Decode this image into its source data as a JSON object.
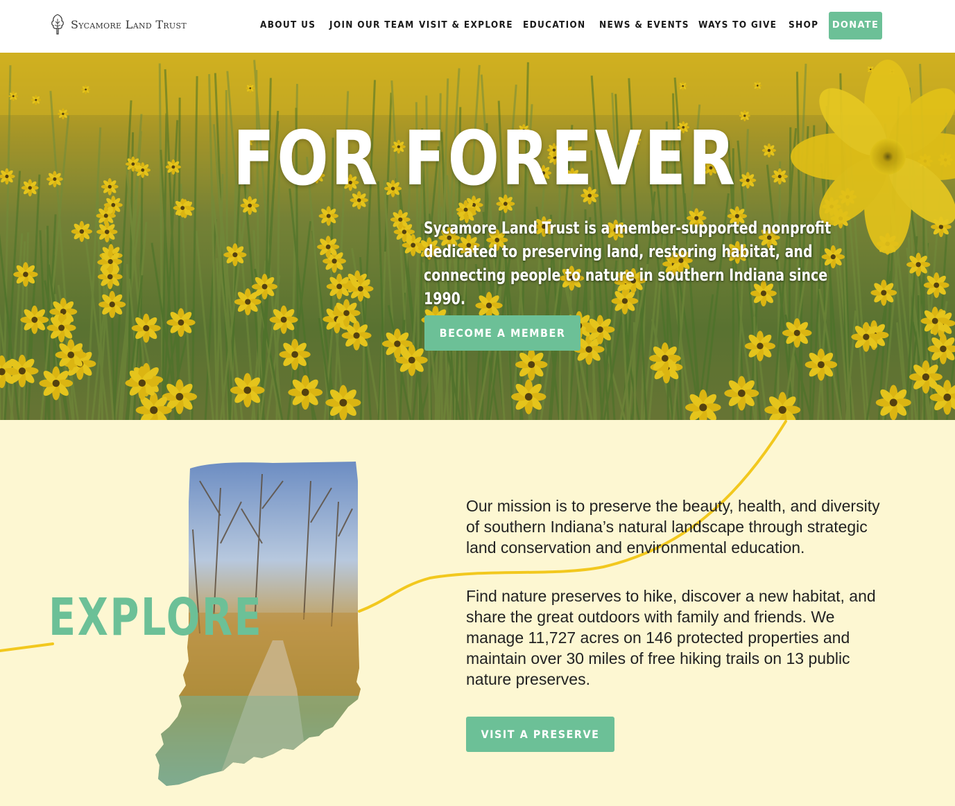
{
  "header": {
    "logo_text": "Sycamore Land Trust",
    "nav": [
      {
        "label": "ABOUT US"
      },
      {
        "label": "JOIN OUR TEAM"
      },
      {
        "label": "VISIT & EXPLORE"
      },
      {
        "label": "EDUCATION"
      },
      {
        "label": "NEWS & EVENTS"
      },
      {
        "label": "WAYS TO GIVE"
      },
      {
        "label": "SHOP"
      }
    ],
    "donate_label": "DONATE"
  },
  "hero": {
    "title": "FOR FOREVER",
    "description": "Sycamore Land Trust is a member-supported nonprofit dedicated to preserving land, restoring habitat, and connecting people to nature in southern Indiana since 1990.",
    "cta_label": "BECOME A MEMBER"
  },
  "explore": {
    "title": "EXPLORE",
    "mission": "Our mission is to preserve the beauty, health, and diversity of southern Indiana’s natural landscape through strategic land conservation and environmental education.",
    "details": "Find nature preserves to hike, discover a new habitat, and share the great outdoors with family and friends. We manage 11,727 acres on 146 protected properties and maintain over 30 miles of free hiking trails on 13 public nature preserves.",
    "cta_label": "VISIT A PRESERVE"
  },
  "colors": {
    "accent_green": "#6cc097",
    "cream_background": "#fdf7d2",
    "squiggle_yellow": "#f2c81e"
  },
  "icons": {
    "logo": "sycamore-tree-icon"
  }
}
